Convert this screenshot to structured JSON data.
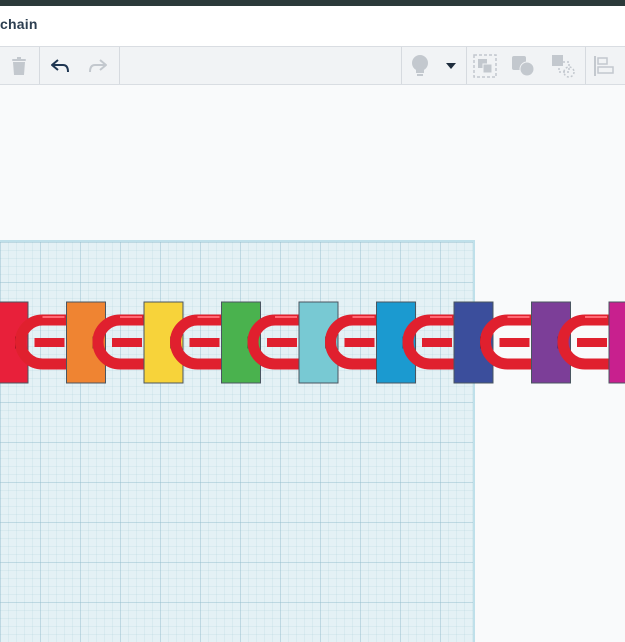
{
  "window": {
    "title": "chain"
  },
  "toolbar": {
    "buttons": [
      {
        "name": "delete",
        "icon": "trash-icon",
        "enabled": false
      },
      {
        "name": "undo",
        "icon": "undo-icon",
        "enabled": true
      },
      {
        "name": "redo",
        "icon": "redo-icon",
        "enabled": false
      },
      {
        "name": "notes",
        "icon": "lightbulb-icon",
        "enabled": false
      },
      {
        "name": "notes-menu",
        "icon": "caret-down-icon",
        "enabled": true
      },
      {
        "name": "group",
        "icon": "group-icon",
        "enabled": false
      },
      {
        "name": "ungroup",
        "icon": "ungroup-icon",
        "enabled": false
      },
      {
        "name": "hole",
        "icon": "hole-icon",
        "enabled": false
      },
      {
        "name": "align",
        "icon": "align-icon",
        "enabled": false
      }
    ]
  },
  "scene": {
    "link_color": "#e0202e",
    "blocks": [
      {
        "color": "#e8203a"
      },
      {
        "color": "#ef8432"
      },
      {
        "color": "#f7d33a"
      },
      {
        "color": "#4ab24e"
      },
      {
        "color": "#78c9d3"
      },
      {
        "color": "#1b9ad0"
      },
      {
        "color": "#3b4e9c"
      },
      {
        "color": "#7c3e98"
      },
      {
        "color": "#c8208e"
      }
    ]
  }
}
